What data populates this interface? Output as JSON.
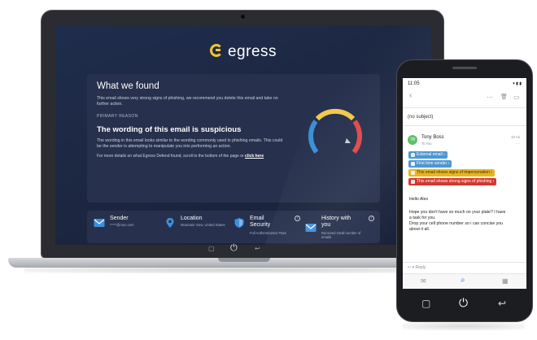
{
  "laptop": {
    "logo": "egress",
    "card": {
      "title": "What we found",
      "summary": "This email shows very strong signs of phishing, we recommend you delete this email and take no further action.",
      "primary_label": "PRIMARY REASON",
      "reason": "The wording of this email is suspicious",
      "reason_detail": "The wording in this email looks similar to the wording commonly used in phishing emails. This could be the sender is attempting to manipulate you into performing an action.",
      "more_details": "For more details on what Egress Defend found, scroll to the bottom of the page or",
      "more_link": "click here"
    },
    "gauge": {
      "level": "high",
      "segment_colors": [
        "#3a8fd6",
        "#f2c94c",
        "#e04848"
      ]
    },
    "info": {
      "sender": {
        "title": "Sender",
        "sub": "*****@mon.com",
        "icon": "envelope-icon"
      },
      "location": {
        "title": "Location",
        "sub": "Mountain View, United States",
        "icon": "map-pin-icon"
      },
      "security": {
        "title": "Email Security",
        "sub": "Full Authentication Pass",
        "icon": "shield-icon"
      },
      "history": {
        "title": "History with you",
        "sub": "Received small number of emails",
        "icon": "envelope-icon"
      }
    },
    "nav": {
      "recent": "▢",
      "home": "⏻",
      "back": "↩"
    }
  },
  "phone": {
    "status_time": "11:05",
    "status_icons": "▾ ▮ ▮",
    "toolbar": {
      "back": "‹",
      "more": "⋯",
      "delete": "🗑",
      "archive": "▭"
    },
    "subject": "(no subject)",
    "sender": {
      "initials": "TB",
      "name": "Tony Boss",
      "to": "To You",
      "time": "10 mi",
      "more": "⋯"
    },
    "badges": [
      {
        "text": "External email",
        "arrow": "›"
      },
      {
        "text": "First time sender",
        "arrow": "›"
      },
      {
        "text": "This email shows signs of impersonation",
        "arrow": "›"
      },
      {
        "text": "This email shows strong signs of phishing",
        "arrow": "›"
      }
    ],
    "greeting": "Hello Alex",
    "body": "Hope you don't have so much on your plate? I have a task for you.",
    "body2": "Drop your cell phone number so i can concise you about it all.",
    "reply": "Reply",
    "tabs": {
      "mail": "✉",
      "search": "⌕",
      "calendar": "▦"
    },
    "nav": {
      "recent": "▢",
      "home": "⏻",
      "back": "↩"
    }
  }
}
